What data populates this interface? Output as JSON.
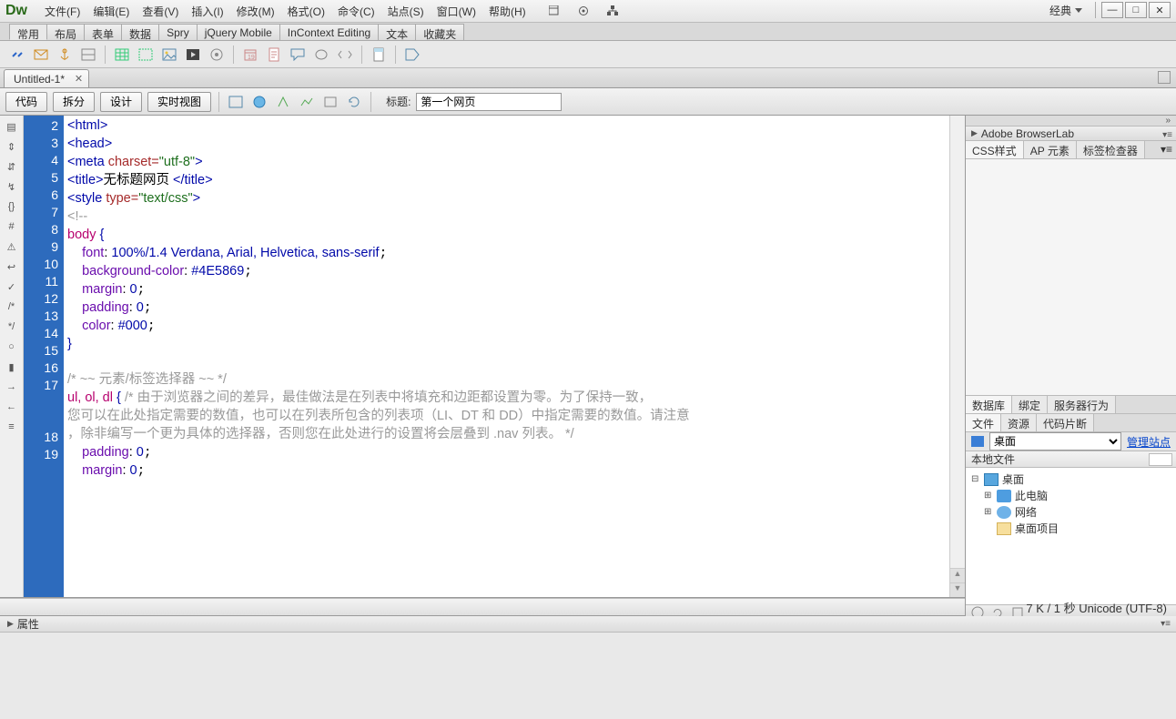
{
  "app": {
    "logo": "Dw"
  },
  "menu": {
    "items": [
      "文件(F)",
      "编辑(E)",
      "查看(V)",
      "插入(I)",
      "修改(M)",
      "格式(O)",
      "命令(C)",
      "站点(S)",
      "窗口(W)",
      "帮助(H)"
    ],
    "workspace_label": "经典"
  },
  "category_tabs": [
    "常用",
    "布局",
    "表单",
    "数据",
    "Spry",
    "jQuery Mobile",
    "InContext Editing",
    "文本",
    "收藏夹"
  ],
  "category_active": 0,
  "document": {
    "tab_title": "Untitled-1*"
  },
  "view_toolbar": {
    "code_btn": "代码",
    "split_btn": "拆分",
    "design_btn": "设计",
    "live_btn": "实时视图",
    "title_label": "标题:",
    "title_value": "第一个网页"
  },
  "code_lines": {
    "start": 2,
    "numbers": [
      "2",
      "3",
      "4",
      "5",
      "6",
      "7",
      "8",
      "9",
      "10",
      "11",
      "12",
      "13",
      "14",
      "15",
      "16",
      "17",
      "",
      "",
      "18",
      "19"
    ]
  },
  "code_text": {
    "l2": "<html>",
    "l3": "<head>",
    "l4a": "<meta ",
    "l4b": "charset=",
    "l4c": "\"utf-8\"",
    "l4d": ">",
    "l5a": "<title>",
    "l5b": "无标题网页",
    "l5c": " </title>",
    "l6a": "<style ",
    "l6b": "type=",
    "l6c": "\"text/css\"",
    "l6d": ">",
    "l7": "<!--",
    "l8a": "body ",
    "l8b": "{",
    "l9a": "    font",
    "l9b": ": ",
    "l9c": "100%/1.4 Verdana, Arial, Helvetica, sans-serif",
    "l10a": "    background-color",
    "l10b": ": ",
    "l10c": "#4E5869",
    "l11a": "    margin",
    "l11b": ": ",
    "l11c": "0",
    "l12a": "    padding",
    "l12b": ": ",
    "l12c": "0",
    "l13a": "    color",
    "l13b": ": ",
    "l13c": "#000",
    "l14": "}",
    "l16": "/* ~~ 元素/标签选择器 ~~ */",
    "l17a": "ul, ol, dl ",
    "l17b": "{ ",
    "l17c": "/* 由于浏览器之间的差异，最佳做法是在列表中将填充和边距都设置为零。为了保持一致，\n您可以在此处指定需要的数值，也可以在列表所包含的列表项（LI、DT 和 DD）中指定需要的数值。请注意\n，除非编写一个更为具体的选择器，否则您在此处进行的设置将会层叠到 .nav 列表。 */",
    "l18a": "    padding",
    "l18b": ": ",
    "l18c": "0",
    "l19a": "    margin",
    "l19b": ": ",
    "l19c": "0"
  },
  "status_bar": {
    "text": "7 K / 1 秒 Unicode (UTF-8)"
  },
  "properties": {
    "label": "属性"
  },
  "right": {
    "browserlab": "Adobe BrowserLab",
    "css_tabs": [
      "CSS样式",
      "AP 元素",
      "标签检查器"
    ],
    "db_tabs": [
      "数据库",
      "绑定",
      "服务器行为"
    ],
    "file_tabs": [
      "文件",
      "资源",
      "代码片断"
    ],
    "files_select": "桌面",
    "files_manage_link": "管理站点",
    "files_header": "本地文件",
    "tree": {
      "root": "桌面",
      "children": [
        "此电脑",
        "网络",
        "桌面项目"
      ]
    }
  }
}
